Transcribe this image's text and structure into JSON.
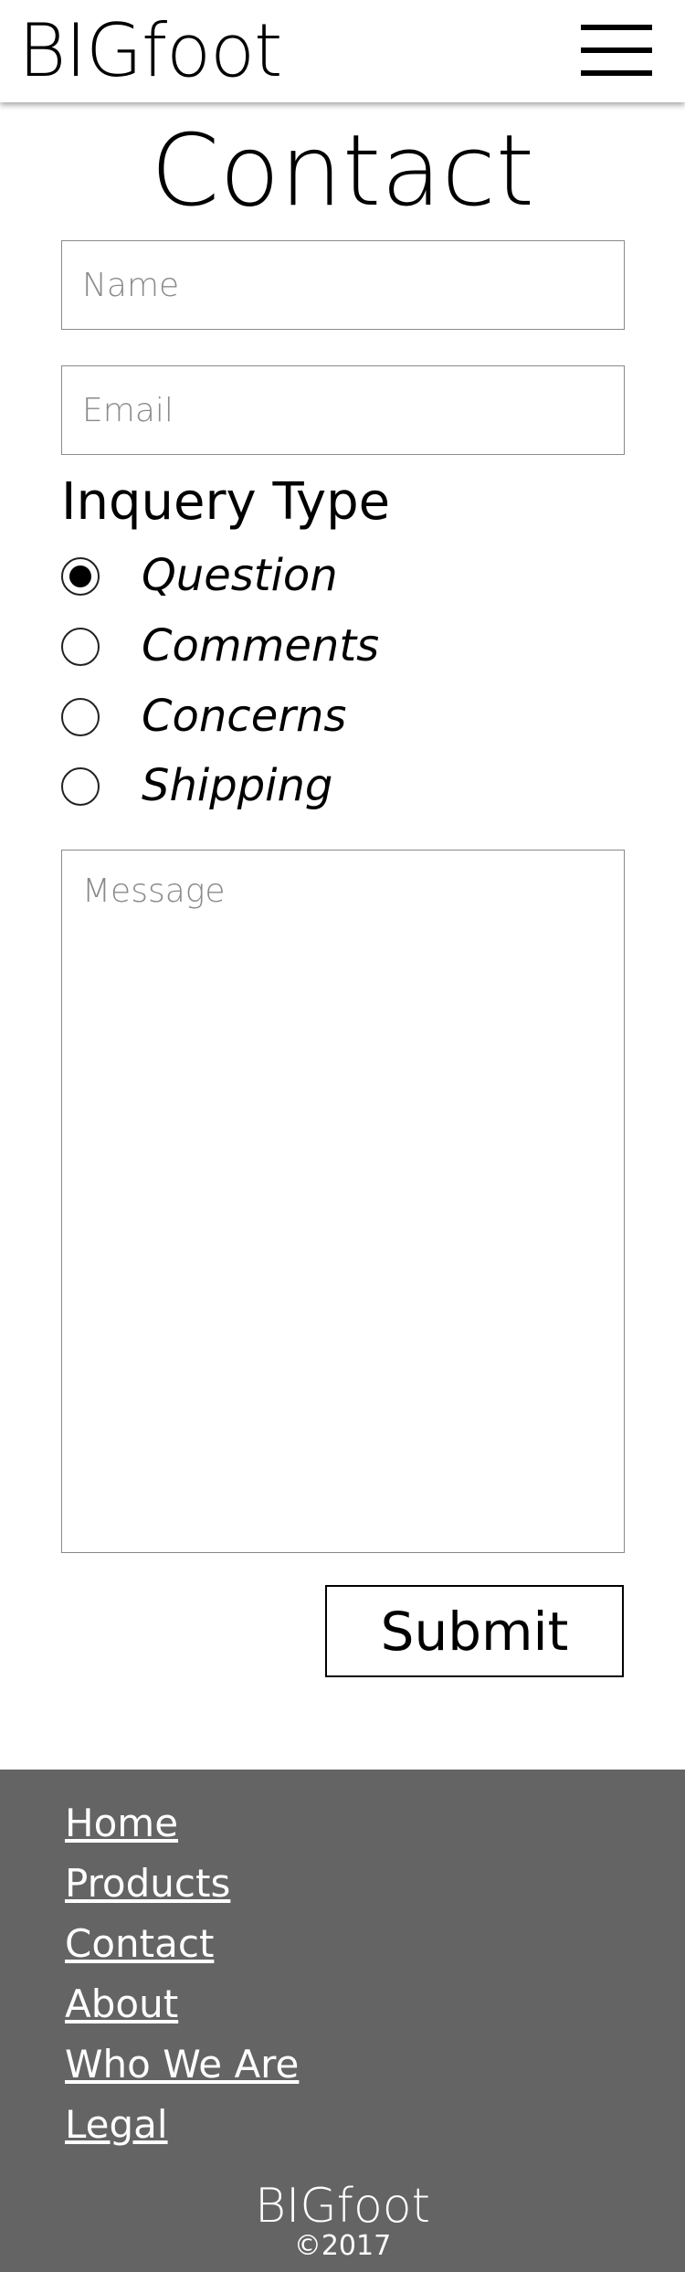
{
  "header": {
    "logo": "BIGfoot",
    "menu_icon": "hamburger-menu-icon"
  },
  "page": {
    "title": "Contact"
  },
  "form": {
    "name_placeholder": "Name",
    "email_placeholder": "Email",
    "inquiry_title": "Inquery Type",
    "inquiry_options": [
      {
        "label": "Question",
        "selected": true
      },
      {
        "label": "Comments",
        "selected": false
      },
      {
        "label": "Concerns",
        "selected": false
      },
      {
        "label": "Shipping",
        "selected": false
      }
    ],
    "message_placeholder": "Message",
    "submit_label": "Submit"
  },
  "footer": {
    "links": [
      "Home",
      "Products",
      "Contact",
      "About",
      "Who We Are",
      "Legal"
    ],
    "logo": "BIGfoot",
    "copyright": "©2017",
    "background_color": "#646464"
  }
}
